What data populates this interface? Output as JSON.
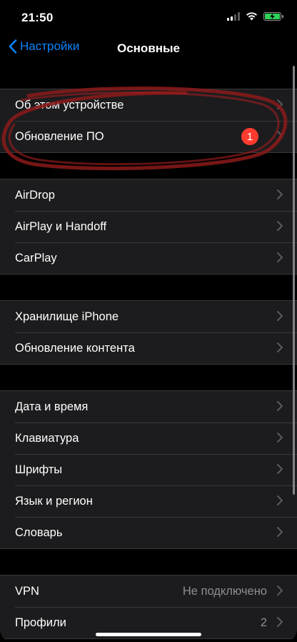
{
  "status_bar": {
    "time": "21:50",
    "battery_color": "#30d158"
  },
  "nav": {
    "back_label": "Настройки",
    "title": "Основные",
    "accent": "#0a84ff"
  },
  "groups": [
    {
      "rows": [
        {
          "label": "Об этом устройстве"
        },
        {
          "label": "Обновление ПО",
          "badge": "1"
        }
      ]
    },
    {
      "rows": [
        {
          "label": "AirDrop"
        },
        {
          "label": "AirPlay и Handoff"
        },
        {
          "label": "CarPlay"
        }
      ]
    },
    {
      "rows": [
        {
          "label": "Хранилище iPhone"
        },
        {
          "label": "Обновление контента"
        }
      ]
    },
    {
      "rows": [
        {
          "label": "Дата и время"
        },
        {
          "label": "Клавиатура"
        },
        {
          "label": "Шрифты"
        },
        {
          "label": "Язык и регион"
        },
        {
          "label": "Словарь"
        }
      ]
    },
    {
      "rows": [
        {
          "label": "VPN",
          "value": "Не подключено"
        },
        {
          "label": "Профили",
          "value": "2"
        }
      ]
    }
  ],
  "annotation_color": "#8b1a1a"
}
